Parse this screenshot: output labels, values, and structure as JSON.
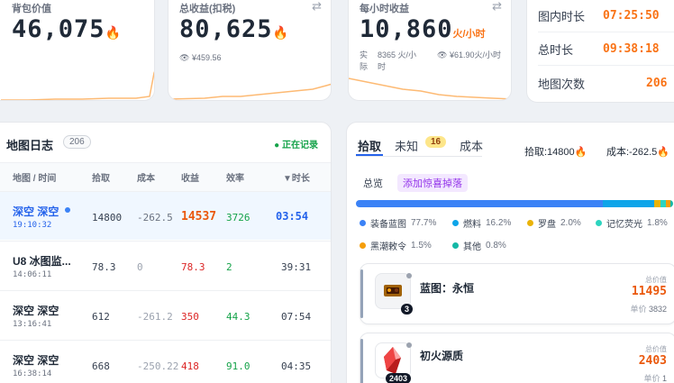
{
  "stats": {
    "bag_value": {
      "title": "背包价值",
      "value": "46,075"
    },
    "total_income": {
      "title": "总收益(扣税)",
      "value": "80,625",
      "sub": "¥459.56"
    },
    "hourly_income": {
      "title": "每小时收益",
      "value": "10,860",
      "unit": "火/小时",
      "actual_label": "实际",
      "actual_value": "8365 火/小时",
      "yuan_value": "¥61.90火/小时"
    }
  },
  "timers": [
    {
      "label": "图内时长",
      "value": "07:25:50"
    },
    {
      "label": "总时长",
      "value": "09:38:18"
    },
    {
      "label": "地图次数",
      "value": "206"
    }
  ],
  "map_log": {
    "title": "地图日志",
    "count": "206",
    "status": "● 正在记录",
    "columns": [
      "地图 / 时间",
      "拾取",
      "成本",
      "收益",
      "效率",
      "▼时长"
    ],
    "rows": [
      {
        "name": "深空 深空",
        "time": "19:10:32",
        "pickup": "14800",
        "cost": "-262.5",
        "income": "14537",
        "eff": "3726",
        "duration": "03:54",
        "active": true
      },
      {
        "name": "U8 冰图监...",
        "time": "14:06:11",
        "pickup": "78.3",
        "cost": "0",
        "income": "78.3",
        "eff": "2",
        "duration": "39:31",
        "active": false
      },
      {
        "name": "深空 深空",
        "time": "13:16:41",
        "pickup": "612",
        "cost": "-261.2",
        "income": "350",
        "eff": "44.3",
        "duration": "07:54",
        "active": false
      },
      {
        "name": "深空 深空",
        "time": "16:38:14",
        "pickup": "668",
        "cost": "-250.22",
        "income": "418",
        "eff": "91.0",
        "duration": "04:35",
        "active": false
      }
    ]
  },
  "detail": {
    "tabs": [
      {
        "label": "拾取"
      },
      {
        "label": "未知"
      },
      {
        "label": "成本"
      }
    ],
    "unknown_badge": "16",
    "pickup_summary": "拾取:14800",
    "cost_summary": "成本:-262.5",
    "chips": {
      "overview": "总览",
      "add_drop": "添加惊喜掉落"
    },
    "legend": [
      {
        "name": "装备蓝图",
        "pct": "77.7%",
        "color": "#3b82f6"
      },
      {
        "name": "燃料",
        "pct": "16.2%",
        "color": "#0ea5e9"
      },
      {
        "name": "罗盘",
        "pct": "2.0%",
        "color": "#eab308"
      },
      {
        "name": "记忆荧光",
        "pct": "1.8%",
        "color": "#2dd4bf"
      },
      {
        "name": "黑潮敕令",
        "pct": "1.5%",
        "color": "#f59e0b"
      },
      {
        "name": "其他",
        "pct": "0.8%",
        "color": "#14b8a6"
      }
    ],
    "items": [
      {
        "name": "蓝图：永恒",
        "count": "3",
        "total_label": "总价值",
        "total": "11495",
        "unit_label": "单价",
        "unit": "3832"
      },
      {
        "name": "初火源质",
        "count": "2403",
        "total_label": "总价值",
        "total": "2403",
        "unit_label": "单价",
        "unit": "1"
      }
    ]
  }
}
